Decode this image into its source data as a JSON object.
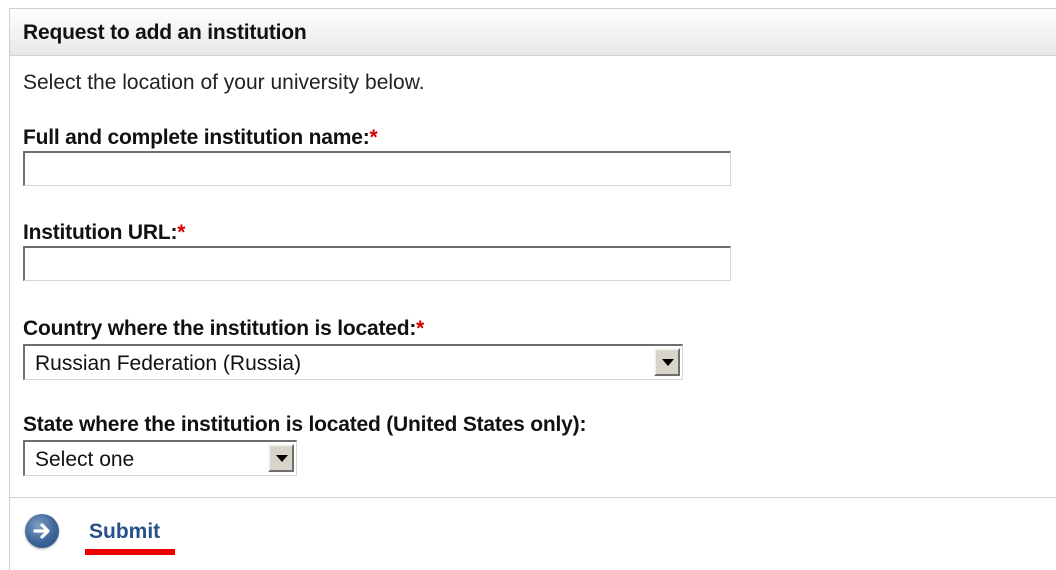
{
  "panel": {
    "title": "Request to add an institution",
    "intro": "Select the location of your university below."
  },
  "fields": {
    "institution_name": {
      "label": "Full and complete institution name:",
      "required_mark": "*",
      "value": ""
    },
    "institution_url": {
      "label": "Institution URL:",
      "required_mark": "*",
      "value": ""
    },
    "country": {
      "label": "Country where the institution is located:",
      "required_mark": "*",
      "selected": "Russian Federation (Russia)"
    },
    "state": {
      "label": "State where the institution is located (United States only):",
      "selected": "Select one"
    }
  },
  "actions": {
    "submit_label": "Submit",
    "submit_icon": "arrow-right-circle-icon"
  },
  "colors": {
    "required": "#d40000",
    "link": "#27518a",
    "annotation": "#ee0000"
  }
}
